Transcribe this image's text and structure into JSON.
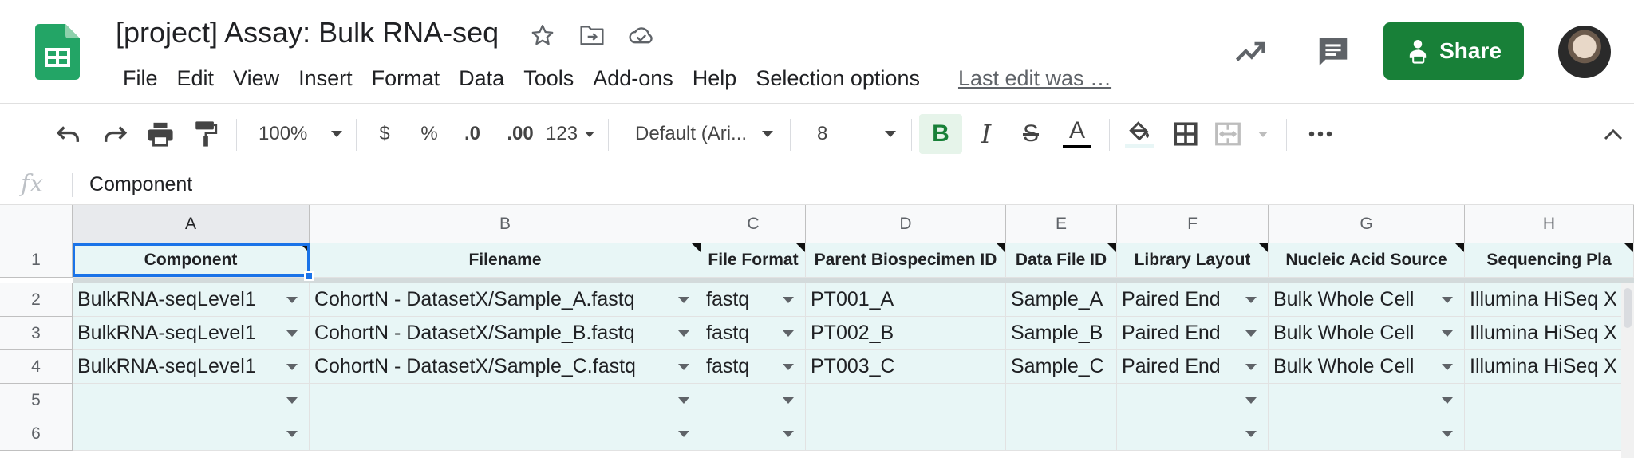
{
  "doc": {
    "title": "[project] Assay: Bulk RNA-seq"
  },
  "menu": {
    "items": [
      "File",
      "Edit",
      "View",
      "Insert",
      "Format",
      "Data",
      "Tools",
      "Add-ons",
      "Help",
      "Selection options"
    ],
    "last_edit": "Last edit was …"
  },
  "share": {
    "label": "Share"
  },
  "toolbar": {
    "zoom": "100%",
    "currency": "$",
    "percent": "%",
    "decrease_decimal": ".0",
    "increase_decimal": ".00",
    "more_formats": "123",
    "font": "Default (Ari...",
    "font_size": "8"
  },
  "formula_bar": {
    "fx": "fx",
    "value": "Component"
  },
  "grid": {
    "columns": [
      "A",
      "B",
      "C",
      "D",
      "E",
      "F",
      "G",
      "H"
    ],
    "rows": [
      "1",
      "2",
      "3",
      "4",
      "5",
      "6"
    ],
    "headers": [
      "Component",
      "Filename",
      "File Format",
      "Parent Biospecimen ID",
      "Data File ID",
      "Library Layout",
      "Nucleic Acid Source",
      "Sequencing Pla"
    ],
    "data": [
      [
        "BulkRNA-seqLevel1",
        "CohortN - DatasetX/Sample_A.fastq",
        "fastq",
        "PT001_A",
        "Sample_A",
        "Paired End",
        "Bulk Whole Cell",
        "Illumina HiSeq X"
      ],
      [
        "BulkRNA-seqLevel1",
        "CohortN - DatasetX/Sample_B.fastq",
        "fastq",
        "PT002_B",
        "Sample_B",
        "Paired End",
        "Bulk Whole Cell",
        "Illumina HiSeq X"
      ],
      [
        "BulkRNA-seqLevel1",
        "CohortN - DatasetX/Sample_C.fastq",
        "fastq",
        "PT003_C",
        "Sample_C",
        "Paired End",
        "Bulk Whole Cell",
        "Illumina HiSeq X"
      ],
      [
        "",
        "",
        "",
        "",
        "",
        "",
        "",
        ""
      ],
      [
        "",
        "",
        "",
        "",
        "",
        "",
        "",
        ""
      ]
    ]
  },
  "colors": {
    "brand_green": "#188038",
    "cell_fill": "#e8f6f6",
    "selection": "#1a73e8",
    "sheets_green": "#23a566"
  }
}
